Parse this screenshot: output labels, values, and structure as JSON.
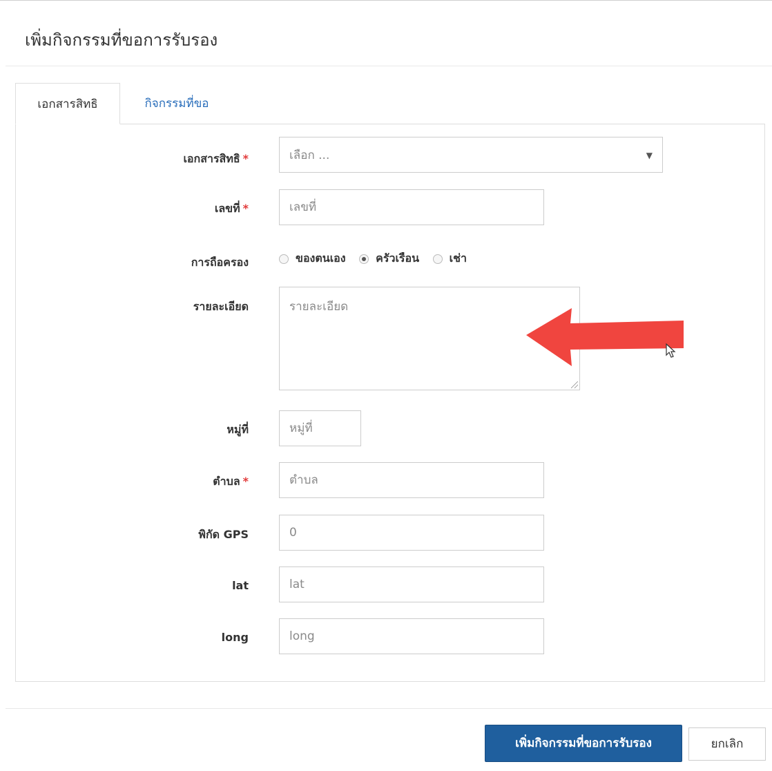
{
  "dialog": {
    "title": "เพิ่มกิจกรรมที่ขอการรับรอง"
  },
  "tabs": [
    {
      "label": "เอกสารสิทธิ",
      "active": true
    },
    {
      "label": "กิจกรรมที่ขอ",
      "active": false
    }
  ],
  "form": {
    "document": {
      "label": "เอกสารสิทธิ",
      "required": "*",
      "selected": "เลือก ..."
    },
    "number": {
      "label": "เลขที่",
      "required": "*",
      "placeholder": "เลขที่"
    },
    "ownership": {
      "label": "การถือครอง",
      "options": [
        {
          "label": "ของตนเอง",
          "checked": false
        },
        {
          "label": "ครัวเรือน",
          "checked": true
        },
        {
          "label": "เช่า",
          "checked": false
        }
      ]
    },
    "details": {
      "label": "รายละเอียด",
      "placeholder": "รายละเอียด"
    },
    "village": {
      "label": "หมู่ที่",
      "placeholder": "หมู่ที่"
    },
    "subdistrict": {
      "label": "ตำบล",
      "required": "*",
      "placeholder": "ตำบล"
    },
    "gps": {
      "label": "พิกัด GPS",
      "value": "0"
    },
    "lat": {
      "label": "lat",
      "placeholder": "lat"
    },
    "long": {
      "label": "long",
      "placeholder": "long"
    }
  },
  "footer": {
    "submit_label": "เพิ่มกิจกรรมที่ขอการรับรอง",
    "cancel_label": "ยกเลิก"
  },
  "colors": {
    "primary_button": "#1f5f9e",
    "link_tab": "#2a6ebb",
    "required_star": "#e23b3b",
    "annotation_arrow": "#f0453f"
  },
  "icons": {
    "select_caret": "caret-down-icon",
    "annotation": "red-arrow-icon",
    "cursor": "mouse-cursor-icon"
  }
}
